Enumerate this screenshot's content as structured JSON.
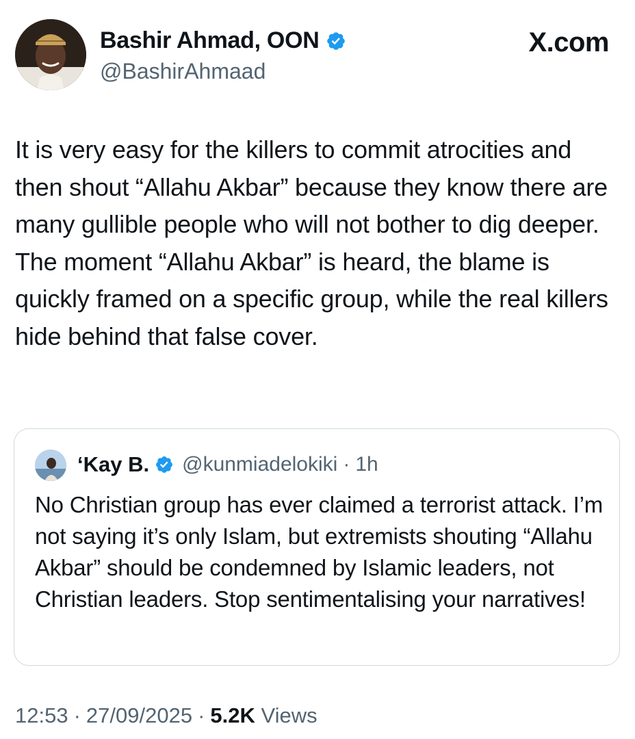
{
  "author": {
    "name": "Bashir Ahmad, OON",
    "handle": "@BashirAhmaad",
    "verified": true
  },
  "brand": "X.com",
  "tweet": {
    "text": "It is very easy for the killers to commit atrocities and then shout “Allahu Akbar” because they know there are many gullible people who will not bother to dig deeper. The moment “Allahu Akbar” is heard, the blame is quickly framed on a specific group, while the real killers hide behind that false cover."
  },
  "quote": {
    "name": "‘Kay B.",
    "handle": "@kunmiadelokiki",
    "separator": "·",
    "time": "1h",
    "verified": true,
    "text": "No Christian group has ever claimed a terrorist attack. I’m not saying it’s only Islam, but extremists shouting “Allahu Akbar” should be condemned by Islamic leaders, not Christian leaders. Stop sentimentalising your narratives!"
  },
  "meta": {
    "time": "12:53",
    "date": "27/09/2025",
    "separator": "·",
    "views_count": "5.2K",
    "views_label": "Views"
  },
  "colors": {
    "verified_badge": "#1d9bf0",
    "secondary_text": "#536471",
    "primary_text": "#0f1419",
    "card_border": "#cfd9de"
  },
  "icons": {
    "verified": "verified-badge-icon",
    "avatar": "avatar-photo",
    "quote_avatar": "quote-avatar-photo"
  }
}
